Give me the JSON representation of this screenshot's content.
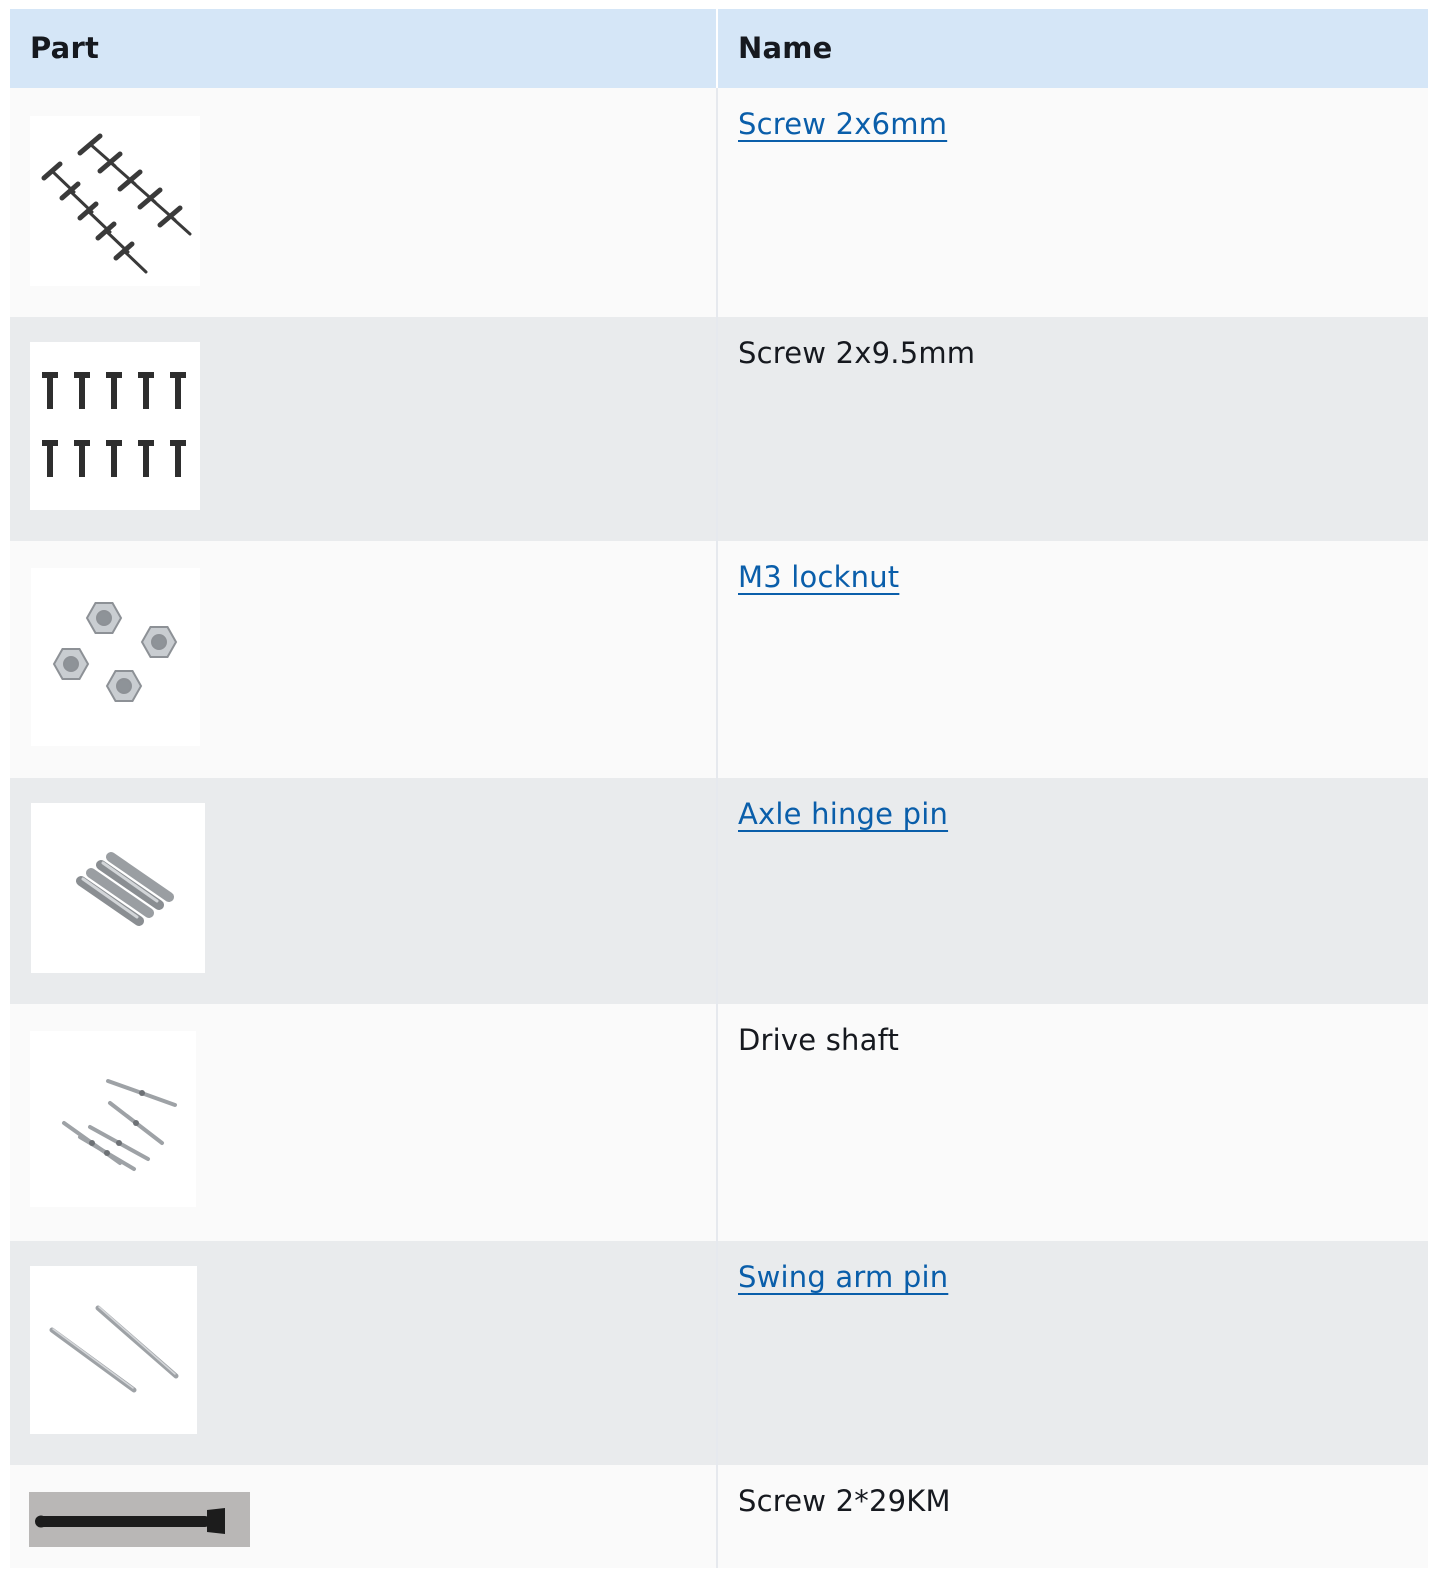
{
  "table": {
    "headers": {
      "part": "Part",
      "name": "Name"
    },
    "rows": [
      {
        "name": "Screw 2x6mm",
        "is_link": true,
        "image_icon": "screws-angled-icon"
      },
      {
        "name": "Screw 2x9.5mm",
        "is_link": false,
        "image_icon": "screws-upright-icon"
      },
      {
        "name": "M3 locknut",
        "is_link": true,
        "image_icon": "locknuts-icon"
      },
      {
        "name": "Axle hinge pin",
        "is_link": true,
        "image_icon": "hinge-pins-icon"
      },
      {
        "name": "Drive shaft",
        "is_link": false,
        "image_icon": "drive-shafts-icon"
      },
      {
        "name": "Swing arm pin",
        "is_link": true,
        "image_icon": "swing-arm-pins-icon"
      },
      {
        "name": "Screw 2*29KM",
        "is_link": false,
        "image_icon": "long-screw-icon"
      }
    ]
  },
  "colors": {
    "header_bg": "#d5e6f7",
    "row_light": "#fafafa",
    "row_dark": "#e9ebed",
    "link": "#0a5eaa",
    "text": "#16191f"
  }
}
